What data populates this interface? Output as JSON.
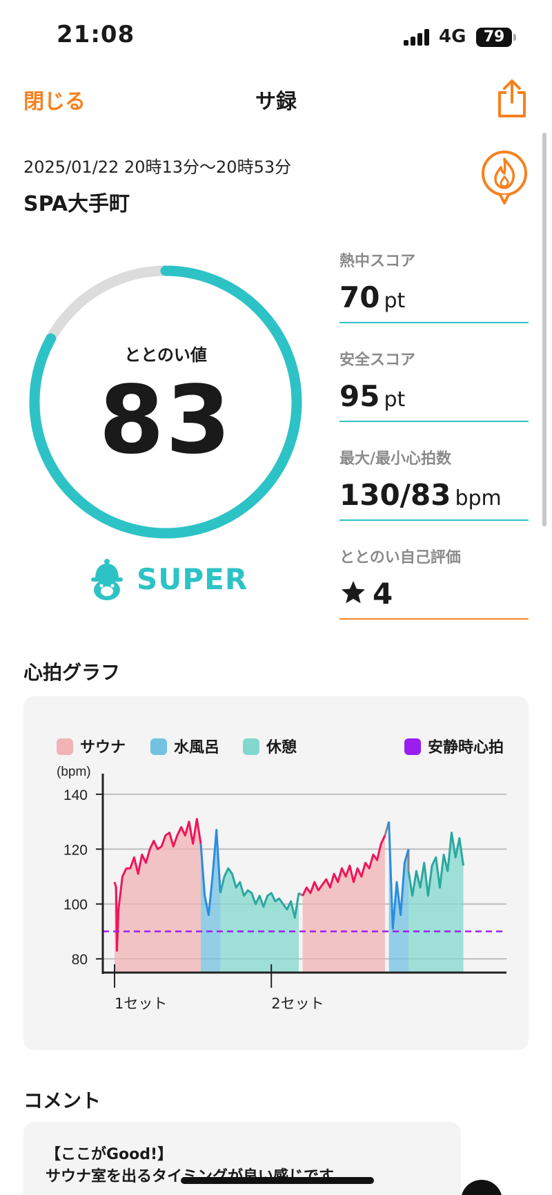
{
  "status_bar": {
    "time": "21:08",
    "network": "4G",
    "battery": "79"
  },
  "nav": {
    "close_label": "閉じる",
    "title": "サ録"
  },
  "session": {
    "datetime": "2025/01/22 20時13分〜20時53分",
    "facility": "SPA大手町"
  },
  "totonoi": {
    "label": "ととのい値",
    "value": "83",
    "progress": 0.83,
    "rank": "SUPER"
  },
  "metrics": [
    {
      "label": "熱中スコア",
      "value": "70",
      "unit": "pt"
    },
    {
      "label": "安全スコア",
      "value": "95",
      "unit": "pt"
    },
    {
      "label": "最大/最小心拍数",
      "value": "130/83",
      "unit": "bpm"
    },
    {
      "label": "ととのい自己評価",
      "value": "4",
      "unit": ""
    }
  ],
  "heart_section_title": "心拍グラフ",
  "legend": {
    "sauna": "サウナ",
    "cold_bath": "水風呂",
    "rest": "休憩",
    "resting_hr": "安静時心拍"
  },
  "colors": {
    "accent": "#f5811f",
    "teal": "#2dc3c6",
    "sauna": "#f0145a",
    "sauna_fill": "#f1b3b6",
    "cold_bath": "#2a8ce0",
    "cold_fill": "#72c2e0",
    "rest": "#2aa89f",
    "rest_fill": "#82d8cf",
    "resting_hr": "#9b1ef0",
    "transition": "#888888"
  },
  "chart_data": {
    "type": "line",
    "ylabel": "(bpm)",
    "ylim": [
      75,
      145
    ],
    "yticks": [
      80,
      100,
      120,
      140
    ],
    "x_tick_labels": [
      {
        "label": "1セット",
        "x": 0
      },
      {
        "label": "2セット",
        "x": 20
      }
    ],
    "resting_hr": 90,
    "grid": true,
    "segments": [
      {
        "phase": "sauna",
        "points": [
          [
            0,
            108
          ],
          [
            0.2,
            106
          ],
          [
            0.3,
            83
          ],
          [
            0.5,
            98
          ],
          [
            1,
            110
          ],
          [
            1.5,
            113
          ],
          [
            2,
            113
          ],
          [
            2.5,
            117
          ],
          [
            3,
            111
          ],
          [
            3.5,
            118
          ],
          [
            4,
            115
          ],
          [
            4.5,
            120
          ],
          [
            5,
            123
          ],
          [
            5.5,
            120
          ],
          [
            6,
            121
          ],
          [
            6.5,
            125
          ],
          [
            7,
            126
          ],
          [
            7.5,
            121
          ],
          [
            8,
            125
          ],
          [
            8.5,
            128
          ],
          [
            9,
            125
          ],
          [
            9.5,
            130
          ],
          [
            10,
            122
          ],
          [
            10.5,
            131
          ],
          [
            11,
            122
          ]
        ]
      },
      {
        "phase": "cold_bath",
        "points": [
          [
            11,
            122
          ],
          [
            11.5,
            103
          ],
          [
            12,
            96
          ],
          [
            12.5,
            110
          ],
          [
            13,
            127
          ],
          [
            13.5,
            104
          ]
        ]
      },
      {
        "phase": "rest",
        "points": [
          [
            13.5,
            104
          ],
          [
            14,
            110
          ],
          [
            14.5,
            113
          ],
          [
            15,
            111
          ],
          [
            15.5,
            106
          ],
          [
            16,
            108
          ],
          [
            16.5,
            103
          ],
          [
            17,
            105
          ],
          [
            17.5,
            104
          ],
          [
            18,
            100
          ],
          [
            18.5,
            103
          ],
          [
            19,
            99
          ],
          [
            19.5,
            103
          ],
          [
            20,
            104
          ],
          [
            20.5,
            101
          ],
          [
            21,
            102
          ],
          [
            21.5,
            100
          ],
          [
            22,
            98
          ],
          [
            22.5,
            101
          ],
          [
            23,
            95
          ],
          [
            23.5,
            104
          ]
        ]
      },
      {
        "phase": "sauna",
        "points": [
          [
            24,
            103
          ],
          [
            24.5,
            106
          ],
          [
            25,
            104
          ],
          [
            25.5,
            108
          ],
          [
            26,
            105
          ],
          [
            26.5,
            107
          ],
          [
            27,
            109
          ],
          [
            27.5,
            106
          ],
          [
            28,
            111
          ],
          [
            28.5,
            108
          ],
          [
            29,
            113
          ],
          [
            29.5,
            110
          ],
          [
            30,
            114
          ],
          [
            30.5,
            108
          ],
          [
            31,
            113
          ],
          [
            31.5,
            110
          ],
          [
            32,
            115
          ],
          [
            32.5,
            113
          ],
          [
            33,
            118
          ],
          [
            33.5,
            116
          ],
          [
            34,
            122
          ],
          [
            34.5,
            125
          ]
        ]
      },
      {
        "phase": "cold_bath",
        "points": [
          [
            35,
            130
          ],
          [
            35.5,
            91
          ],
          [
            36,
            108
          ],
          [
            36.5,
            96
          ],
          [
            37,
            115
          ],
          [
            37.5,
            120
          ]
        ]
      },
      {
        "phase": "rest",
        "points": [
          [
            37.5,
            112
          ],
          [
            38,
            103
          ],
          [
            38.5,
            112
          ],
          [
            39,
            106
          ],
          [
            39.5,
            115
          ],
          [
            40,
            103
          ],
          [
            40.5,
            114
          ],
          [
            41,
            117
          ],
          [
            41.5,
            106
          ],
          [
            42,
            118
          ],
          [
            42.5,
            112
          ],
          [
            43,
            126
          ],
          [
            43.5,
            117
          ],
          [
            44,
            124
          ],
          [
            44.5,
            114
          ]
        ]
      }
    ]
  },
  "comment": {
    "title": "コメント",
    "body": "【ここがGood!】\nサウナ室を出るタイミングが良い感じです"
  }
}
